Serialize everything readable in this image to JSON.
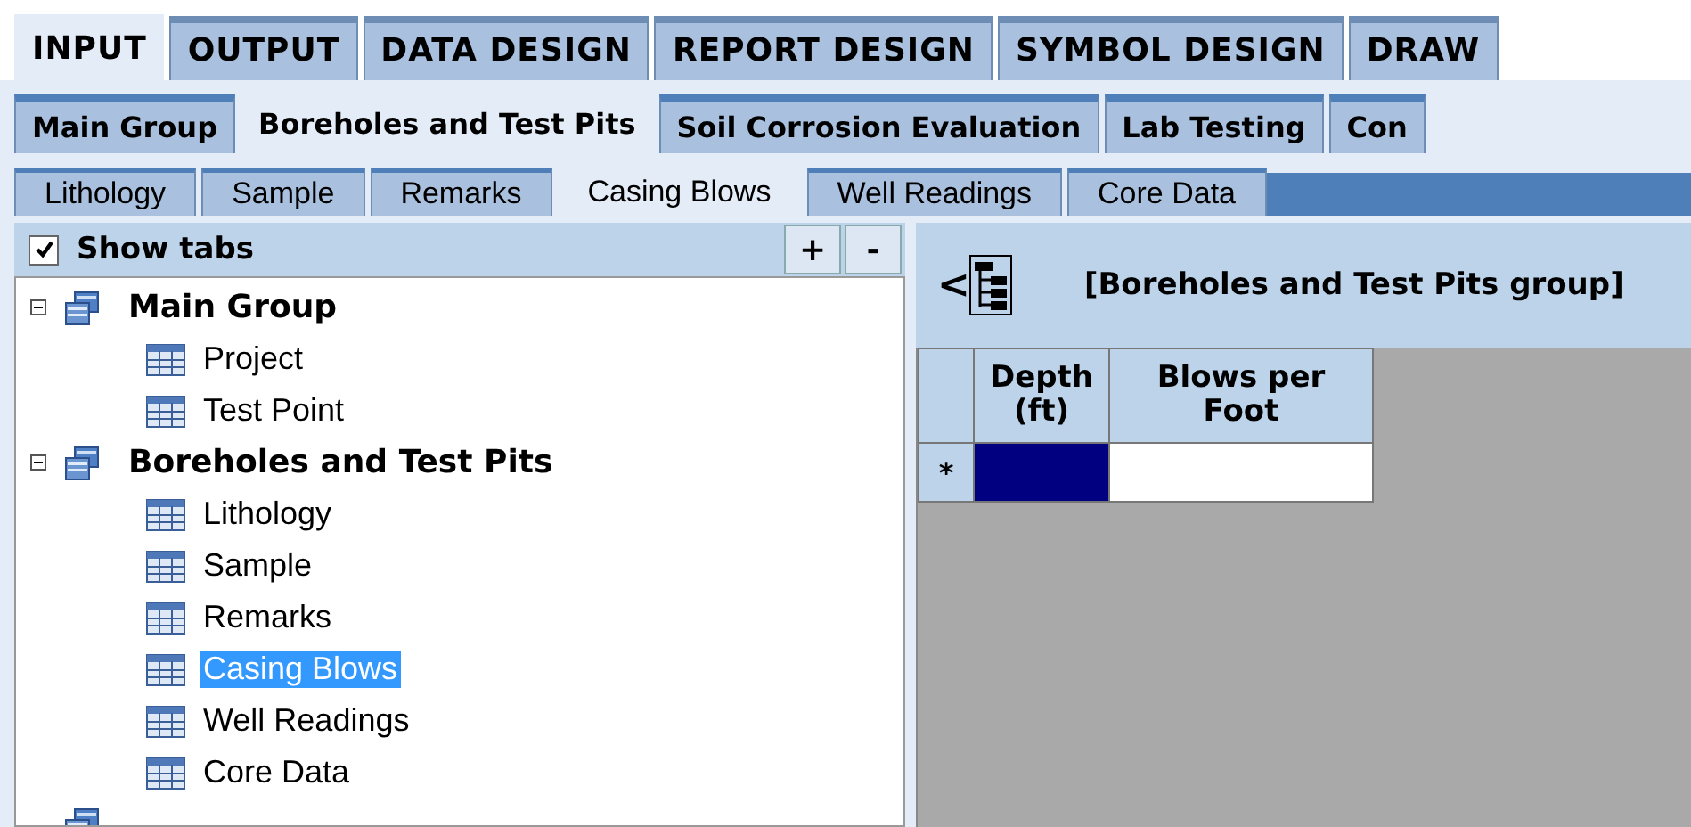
{
  "main_tabs": [
    {
      "label": "INPUT",
      "selected": true
    },
    {
      "label": "OUTPUT",
      "selected": false
    },
    {
      "label": "DATA DESIGN",
      "selected": false
    },
    {
      "label": "REPORT DESIGN",
      "selected": false
    },
    {
      "label": "SYMBOL DESIGN",
      "selected": false
    },
    {
      "label": "DRAW",
      "selected": false
    }
  ],
  "group_tabs": [
    {
      "label": "Main Group",
      "selected": false
    },
    {
      "label": "Boreholes and Test Pits",
      "selected": true
    },
    {
      "label": "Soil Corrosion Evaluation",
      "selected": false
    },
    {
      "label": "Lab Testing",
      "selected": false
    },
    {
      "label": "Con",
      "selected": false
    }
  ],
  "table_tabs": [
    {
      "label": "Lithology",
      "selected": false
    },
    {
      "label": "Sample",
      "selected": false
    },
    {
      "label": "Remarks",
      "selected": false
    },
    {
      "label": "Casing Blows",
      "selected": true
    },
    {
      "label": "Well Readings",
      "selected": false
    },
    {
      "label": "Core Data",
      "selected": false
    }
  ],
  "show_tabs": {
    "label": "Show tabs",
    "checked": true
  },
  "tree_buttons": [
    "+",
    "-"
  ],
  "tree": [
    {
      "label": "Main Group",
      "expanded": true,
      "children": [
        {
          "label": "Project",
          "selected": false
        },
        {
          "label": "Test Point",
          "selected": false
        }
      ]
    },
    {
      "label": "Boreholes and Test Pits",
      "expanded": true,
      "children": [
        {
          "label": "Lithology",
          "selected": false
        },
        {
          "label": "Sample",
          "selected": false
        },
        {
          "label": "Remarks",
          "selected": false
        },
        {
          "label": "Casing Blows",
          "selected": true
        },
        {
          "label": "Well Readings",
          "selected": false
        },
        {
          "label": "Core Data",
          "selected": false
        }
      ]
    },
    {
      "kind": "group"
    }
  ],
  "panel": {
    "back": "<",
    "title": "[Boreholes and Test Pits group]"
  },
  "grid": {
    "columns": [
      "Depth\n(ft)",
      "Blows per\nFoot"
    ],
    "rows": [
      {
        "marker": "*",
        "cells": [
          {
            "selected": true
          },
          {
            "selected": false
          }
        ]
      }
    ]
  }
}
